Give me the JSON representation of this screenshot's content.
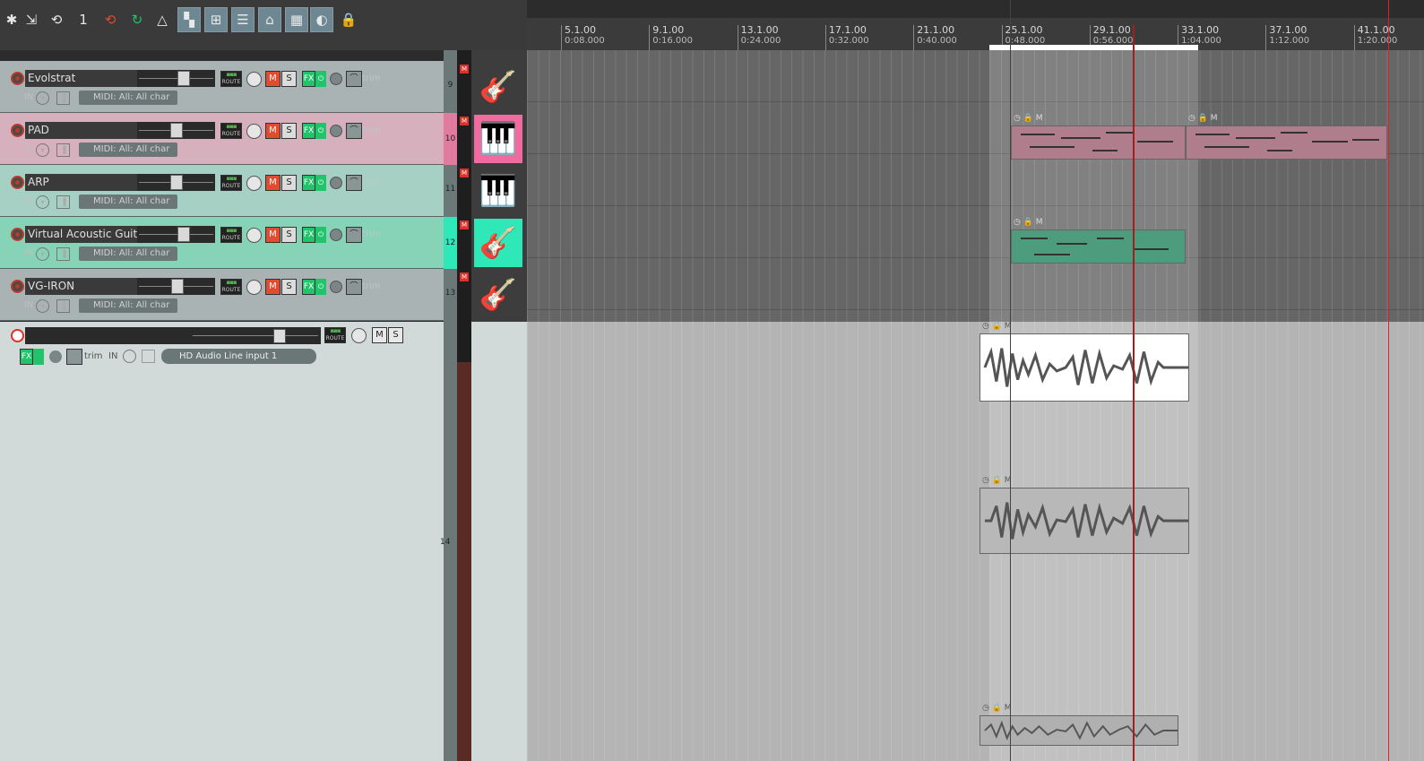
{
  "toolbar": {
    "buttons": [
      {
        "name": "new-track-icon",
        "glyph": "✱"
      },
      {
        "name": "import-icon",
        "glyph": "⇲"
      },
      {
        "name": "render-icon",
        "glyph": "⟲"
      },
      {
        "name": "project-tab-icon",
        "glyph": "1"
      },
      {
        "name": "loop-icon",
        "glyph": "⟲"
      },
      {
        "name": "ripple-icon",
        "glyph": "↻"
      },
      {
        "name": "metronome-icon",
        "glyph": "△"
      },
      {
        "name": "snap-icon",
        "glyph": "▚"
      },
      {
        "name": "grid-link-icon",
        "glyph": "⊞"
      },
      {
        "name": "item-grouping-icon",
        "glyph": "☰"
      },
      {
        "name": "crossfade-icon",
        "glyph": "⌂"
      },
      {
        "name": "grid-icon",
        "glyph": "▦"
      },
      {
        "name": "autoscroll-icon",
        "glyph": "◐"
      },
      {
        "name": "lock-icon",
        "glyph": "🔒"
      }
    ]
  },
  "tracks": [
    {
      "num": "9",
      "name": "Evolstrat",
      "color": "#a9b3b3",
      "input": "MIDI: All: All char",
      "fader": 0.62,
      "icon": "electric-guitar-icon",
      "glyph": "🎸",
      "iconbg": "#3d3d3d"
    },
    {
      "num": "10",
      "name": "PAD",
      "color": "#d6b0bc",
      "input": "MIDI: All: All char",
      "fader": 0.5,
      "icon": "piano-icon",
      "glyph": "🎹",
      "iconbg": "#f06ba0"
    },
    {
      "num": "11",
      "name": "ARP",
      "color": "#a6d0c4",
      "input": "MIDI: All: All char",
      "fader": 0.5,
      "icon": "synth-icon",
      "glyph": "🎹",
      "iconbg": "#3d3d3d"
    },
    {
      "num": "12",
      "name": "Virtual Acoustic Guita",
      "color": "#86d3b8",
      "input": "MIDI: All: All char",
      "fader": 0.62,
      "icon": "acoustic-guitar-icon",
      "glyph": "🎸",
      "iconbg": "#2ee8b8"
    },
    {
      "num": "13",
      "name": "VG-IRON",
      "color": "#a9b3b3",
      "input": "MIDI: All: All char",
      "fader": 0.52,
      "icon": "electric-guitar-icon",
      "glyph": "🎸",
      "iconbg": "#3d3d3d"
    }
  ],
  "track14": {
    "num": "14",
    "name": "",
    "input": "HD Audio Line input 1",
    "route_label": "ROUTE",
    "mute_label": "M",
    "solo_label": "S",
    "fx_label": "FX",
    "trim_label": "trim",
    "in_label": "IN"
  },
  "labels": {
    "route": "ROUTE",
    "mute": "M",
    "solo": "S",
    "fx": "FX",
    "trim": "trim",
    "in": "IN",
    "mute_badge": "M"
  },
  "ruler": {
    "marks": [
      {
        "bar": "5.1.00",
        "time": "0:08.000"
      },
      {
        "bar": "9.1.00",
        "time": "0:16.000"
      },
      {
        "bar": "13.1.00",
        "time": "0:24.000"
      },
      {
        "bar": "17.1.00",
        "time": "0:32.000"
      },
      {
        "bar": "21.1.00",
        "time": "0:40.000"
      },
      {
        "bar": "25.1.00",
        "time": "0:48.000"
      },
      {
        "bar": "29.1.00",
        "time": "0:56.000"
      },
      {
        "bar": "33.1.00",
        "time": "1:04.000"
      },
      {
        "bar": "37.1.00",
        "time": "1:12.000"
      },
      {
        "bar": "41.1.00",
        "time": "1:20.000"
      }
    ]
  },
  "item_header": {
    "midi": "◷ 🔒 M",
    "audio": "◷ 🔒 M"
  },
  "colors": {
    "pad_item": "#b07d8c",
    "guitar_item": "#4e9c7e",
    "accent_red": "#e24b2f",
    "fx_green": "#21c46a"
  }
}
